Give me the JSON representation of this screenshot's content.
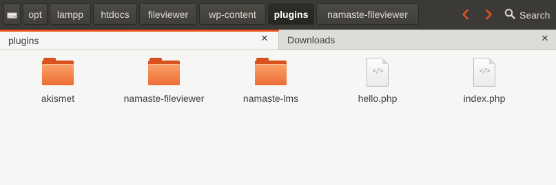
{
  "toolbar": {
    "breadcrumbs": [
      {
        "label": "opt"
      },
      {
        "label": "lampp"
      },
      {
        "label": "htdocs"
      },
      {
        "label": "fileviewer"
      },
      {
        "label": "wp-content"
      },
      {
        "label": "plugins"
      },
      {
        "label": "namaste-fileviewer"
      }
    ],
    "active_crumb": "plugins",
    "search_label": "Search",
    "accent": "#e95420"
  },
  "tabs": [
    {
      "label": "plugins",
      "active": true
    },
    {
      "label": "Downloads",
      "active": false
    }
  ],
  "files": [
    {
      "name": "akismet",
      "type": "folder",
      "icon": "folder-icon"
    },
    {
      "name": "namaste-fileviewer",
      "type": "folder",
      "icon": "folder-icon"
    },
    {
      "name": "namaste-lms",
      "type": "folder",
      "icon": "folder-icon"
    },
    {
      "name": "hello.php",
      "type": "file",
      "icon": "php-file-icon",
      "glyph": "</>"
    },
    {
      "name": "index.php",
      "type": "file",
      "icon": "php-file-icon",
      "glyph": "</>"
    }
  ]
}
